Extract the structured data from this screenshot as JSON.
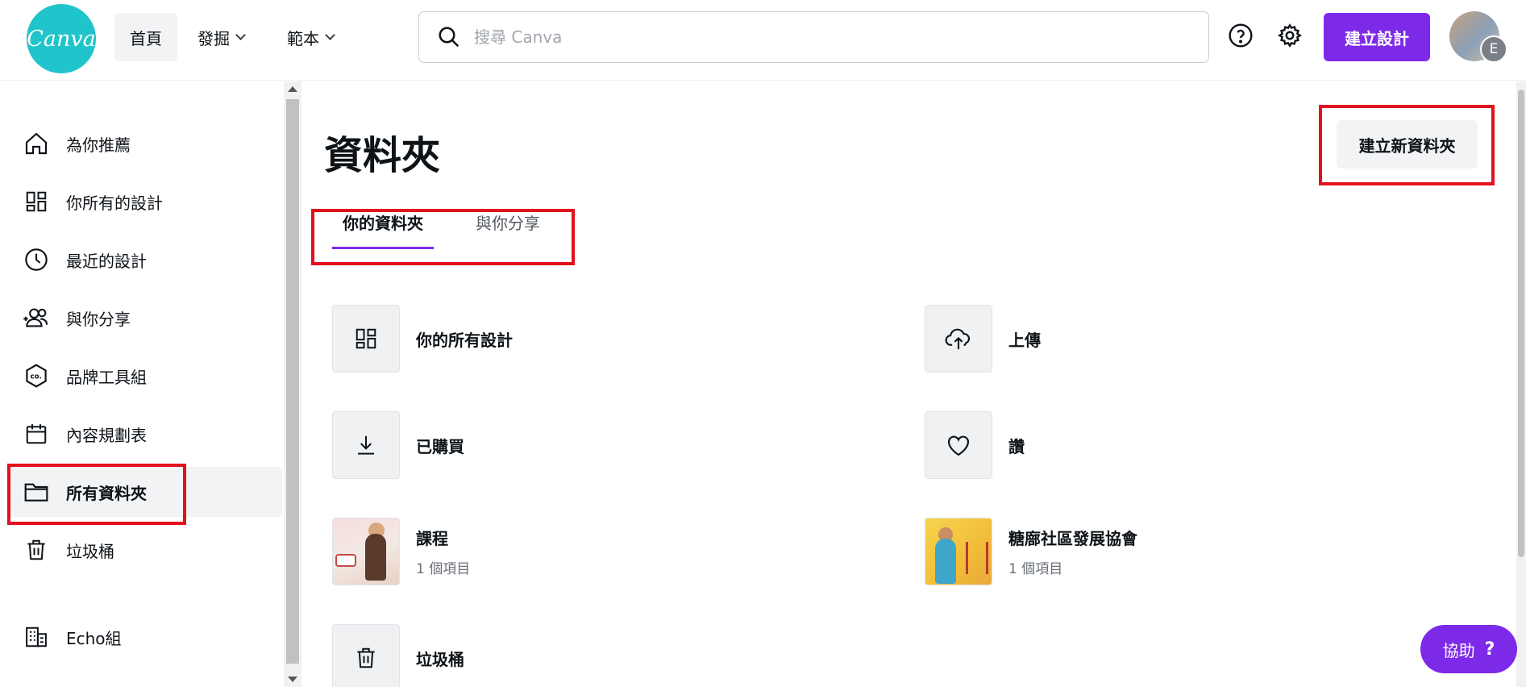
{
  "header": {
    "logo_text": "Canva",
    "nav": [
      {
        "label": "首頁",
        "has_dropdown": false,
        "active": true
      },
      {
        "label": "發掘",
        "has_dropdown": true
      },
      {
        "label": "範本",
        "has_dropdown": true
      }
    ],
    "search": {
      "placeholder": "搜尋 Canva",
      "value": ""
    },
    "help_icon": "question-circle-icon",
    "settings_icon": "gear-icon",
    "create_button": "建立設計",
    "avatar_badge": "E"
  },
  "sidebar": {
    "items": [
      {
        "label": "為你推薦",
        "icon": "home-icon"
      },
      {
        "label": "你所有的設計",
        "icon": "grid-icon"
      },
      {
        "label": "最近的設計",
        "icon": "clock-icon"
      },
      {
        "label": "與你分享",
        "icon": "people-icon"
      },
      {
        "label": "品牌工具組",
        "icon": "brand-kit-icon"
      },
      {
        "label": "內容規劃表",
        "icon": "calendar-icon"
      },
      {
        "label": "所有資料夾",
        "icon": "folder-icon",
        "active": true
      },
      {
        "label": "垃圾桶",
        "icon": "trash-icon"
      },
      {
        "label": "Echo組",
        "icon": "building-icon"
      }
    ]
  },
  "main": {
    "title": "資料夾",
    "new_folder_button": "建立新資料夾",
    "tabs": [
      {
        "label": "你的資料夾",
        "active": true
      },
      {
        "label": "與你分享",
        "active": false
      }
    ],
    "folders": [
      {
        "name": "你的所有設計",
        "icon": "grid-icon"
      },
      {
        "name": "上傳",
        "icon": "cloud-upload-icon"
      },
      {
        "name": "已購買",
        "icon": "download-icon"
      },
      {
        "name": "讚",
        "icon": "heart-icon"
      },
      {
        "name": "課程",
        "count": "1 個項目",
        "thumbnail": "course-thumbnail"
      },
      {
        "name": "糖廍社區發展協會",
        "count": "1 個項目",
        "thumbnail": "association-thumbnail"
      },
      {
        "name": "垃圾桶",
        "icon": "trash-icon"
      }
    ]
  },
  "help_fab": {
    "label": "協助",
    "glyph": "?"
  },
  "colors": {
    "brand_purple": "#7d2ae8",
    "logo_teal": "#20c4cb",
    "highlight_red": "#e3101e"
  }
}
